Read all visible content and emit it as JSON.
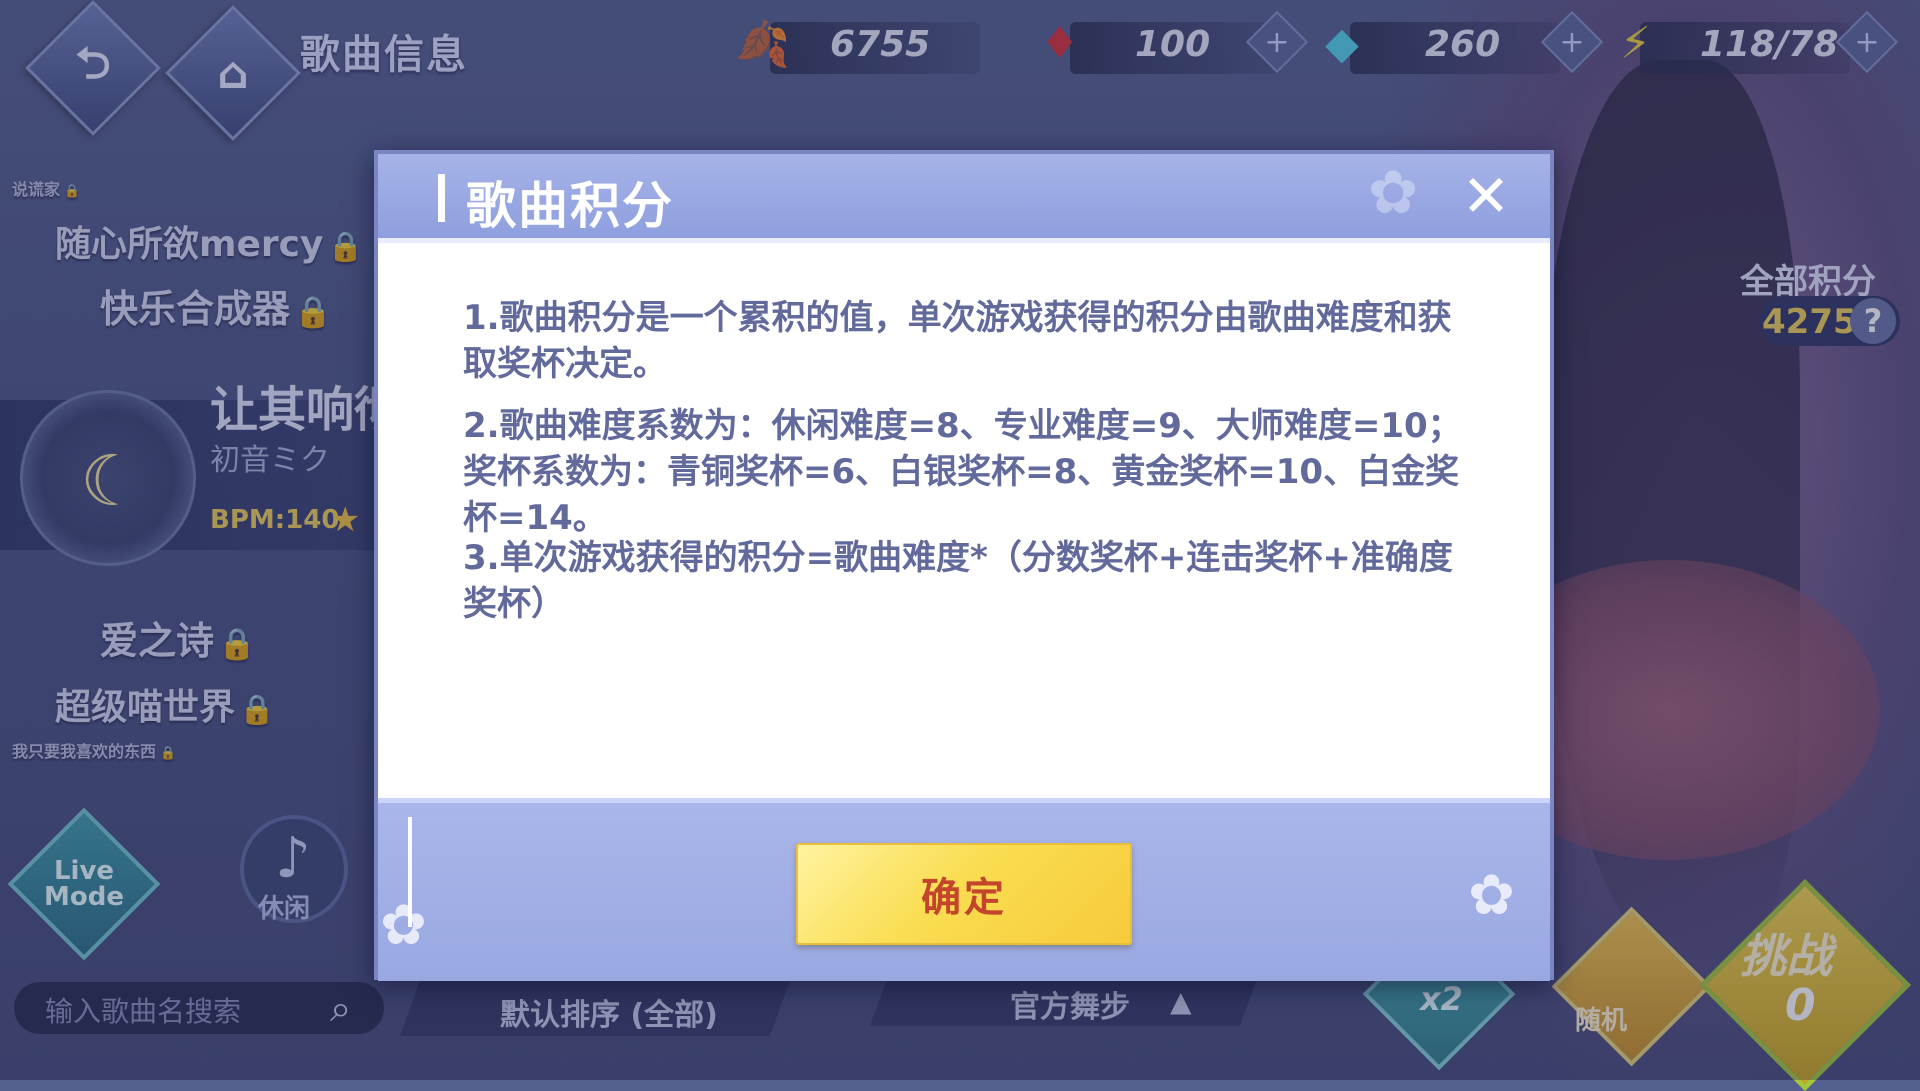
{
  "header": {
    "page_title": "歌曲信息",
    "back_glyph": "⮌",
    "home_glyph": "⌂",
    "resources": [
      {
        "name": "ginkgo",
        "icon": "🍂",
        "value": "6755"
      },
      {
        "name": "ruby",
        "icon": "♦",
        "value": "100"
      },
      {
        "name": "diamond",
        "icon": "◆",
        "value": "260"
      },
      {
        "name": "energy",
        "icon": "⚡",
        "value": "118/78"
      }
    ],
    "plus_glyph": "+"
  },
  "song_list": {
    "items_top": [
      {
        "label": "说谎家",
        "size": "small"
      },
      {
        "label": "随心所欲mercy"
      },
      {
        "label": "快乐合成器"
      }
    ],
    "selected": {
      "title": "让其响彻",
      "artist": "初音ミク",
      "bpm": "BPM:140"
    },
    "items_bottom": [
      {
        "label": "爱之诗"
      },
      {
        "label": "超级喵世界"
      },
      {
        "label": "我只要我喜欢的东西",
        "size": "small"
      }
    ],
    "lock_glyph": "🔒"
  },
  "total_score": {
    "label": "全部积分",
    "value": "4275",
    "help": "?"
  },
  "bottom": {
    "live_mode_line1": "Live",
    "live_mode_line2": "Mode",
    "casual_label": "休闲",
    "search_placeholder": "输入歌曲名搜索",
    "sort_label": "默认排序 (全部)",
    "step_label": "官方舞步",
    "x2_label": "x2",
    "random_label": "随机",
    "challenge_label": "挑战",
    "challenge_count": "0"
  },
  "modal": {
    "title": "歌曲积分",
    "close_glyph": "✕",
    "paragraphs": [
      "1.歌曲积分是一个累积的值，单次游戏获得的积分由歌曲难度和获取奖杯决定。",
      "2.歌曲难度系数为：休闲难度=8、专业难度=9、大师难度=10；奖杯系数为：青铜奖杯=6、白银奖杯=8、黄金奖杯=10、白金奖杯=14。",
      "3.单次游戏获得的积分=歌曲难度*（分数奖杯+连击奖杯+准确度奖杯）"
    ],
    "confirm_label": "确定"
  },
  "colors": {
    "accent_yellow": "#f6cb3a",
    "confirm_text": "#c3452c",
    "modal_header": "#8f9fde",
    "body_text": "#626a9c"
  }
}
